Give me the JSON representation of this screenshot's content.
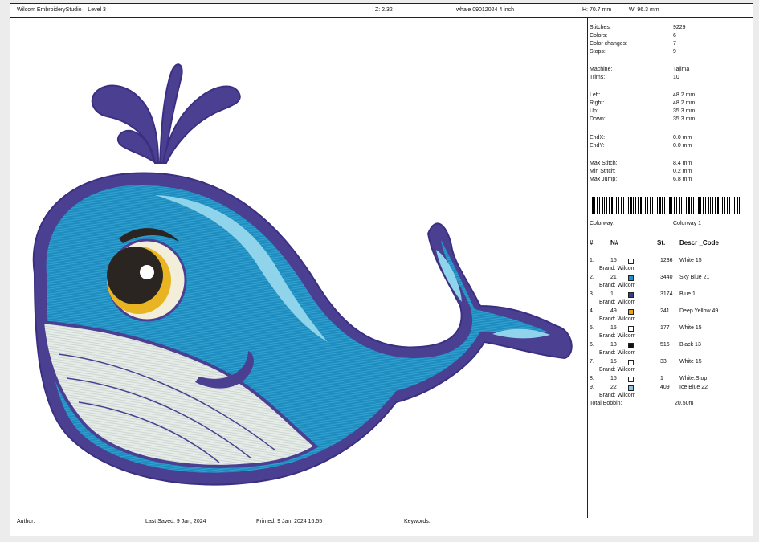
{
  "header": {
    "app_title": "Wilcom EmbroideryStudio – Level 3",
    "zoom": "Z: 2.32",
    "file_name": "whale 09012024 4 inch",
    "height": "H: 70.7 mm",
    "width": "W: 96.3 mm"
  },
  "stats": [
    {
      "label": "Stitches:",
      "value": "9229"
    },
    {
      "label": "Colors:",
      "value": "6"
    },
    {
      "label": "Color changes:",
      "value": "7"
    },
    {
      "label": "Stops:",
      "value": "9"
    },
    {
      "label": "Machine:",
      "value": "Tajima"
    },
    {
      "label": "Trims:",
      "value": "10"
    },
    {
      "label": "Left:",
      "value": "48.2 mm"
    },
    {
      "label": "Right:",
      "value": "48.2 mm"
    },
    {
      "label": "Up:",
      "value": "35.3 mm"
    },
    {
      "label": "Down:",
      "value": "35.3 mm"
    },
    {
      "label": "EndX:",
      "value": "0.0 mm"
    },
    {
      "label": "EndY:",
      "value": "0.0 mm"
    },
    {
      "label": "Max Stitch:",
      "value": "8.4 mm"
    },
    {
      "label": "Min Stitch:",
      "value": "0.2 mm"
    },
    {
      "label": "Max Jump:",
      "value": "6.8 mm"
    }
  ],
  "colorway": {
    "label": "Colorway:",
    "value": "Colorway 1"
  },
  "table": {
    "headers": {
      "num": "#",
      "needle": "N#",
      "stitches": "St.",
      "descr": "Descr _Code"
    },
    "rows": [
      {
        "num": "1.",
        "needle": "15",
        "color": "#ffffff",
        "stitches": "1236",
        "descr": "White 15",
        "brand": "Brand: Wilcom"
      },
      {
        "num": "2.",
        "needle": "21",
        "color": "#1f8fd0",
        "stitches": "3440",
        "descr": "Sky Blue 21",
        "brand": "Brand: Wilcom"
      },
      {
        "num": "3.",
        "needle": "1",
        "color": "#3a3a8e",
        "stitches": "3174",
        "descr": "Blue 1",
        "brand": "Brand: Wilcom"
      },
      {
        "num": "4.",
        "needle": "49",
        "color": "#e8a319",
        "stitches": "241",
        "descr": "Deep Yellow 49",
        "brand": "Brand: Wilcom"
      },
      {
        "num": "5.",
        "needle": "15",
        "color": "#ffffff",
        "stitches": "177",
        "descr": "White 15",
        "brand": "Brand: Wilcom"
      },
      {
        "num": "6.",
        "needle": "13",
        "color": "#111111",
        "stitches": "516",
        "descr": "Black 13",
        "brand": "Brand: Wilcom"
      },
      {
        "num": "7.",
        "needle": "15",
        "color": "#ffffff",
        "stitches": "33",
        "descr": "White 15",
        "brand": "Brand: Wilcom"
      },
      {
        "num": "8.",
        "needle": "15",
        "color": "#ffffff",
        "stitches": "1",
        "descr": "White.Stop",
        "brand": ""
      },
      {
        "num": "9.",
        "needle": "22",
        "color": "#8ec5e6",
        "stitches": "409",
        "descr": "Ice Blue 22",
        "brand": "Brand: Wilcom"
      }
    ]
  },
  "total_bobbin": {
    "label": "Total Bobbin:",
    "value": "20.50m"
  },
  "footer": {
    "author": "Author:",
    "last_saved": "Last Saved:  9 Jan, 2024",
    "printed": "Printed:  9 Jan, 2024 16:55",
    "keywords": "Keywords:"
  }
}
